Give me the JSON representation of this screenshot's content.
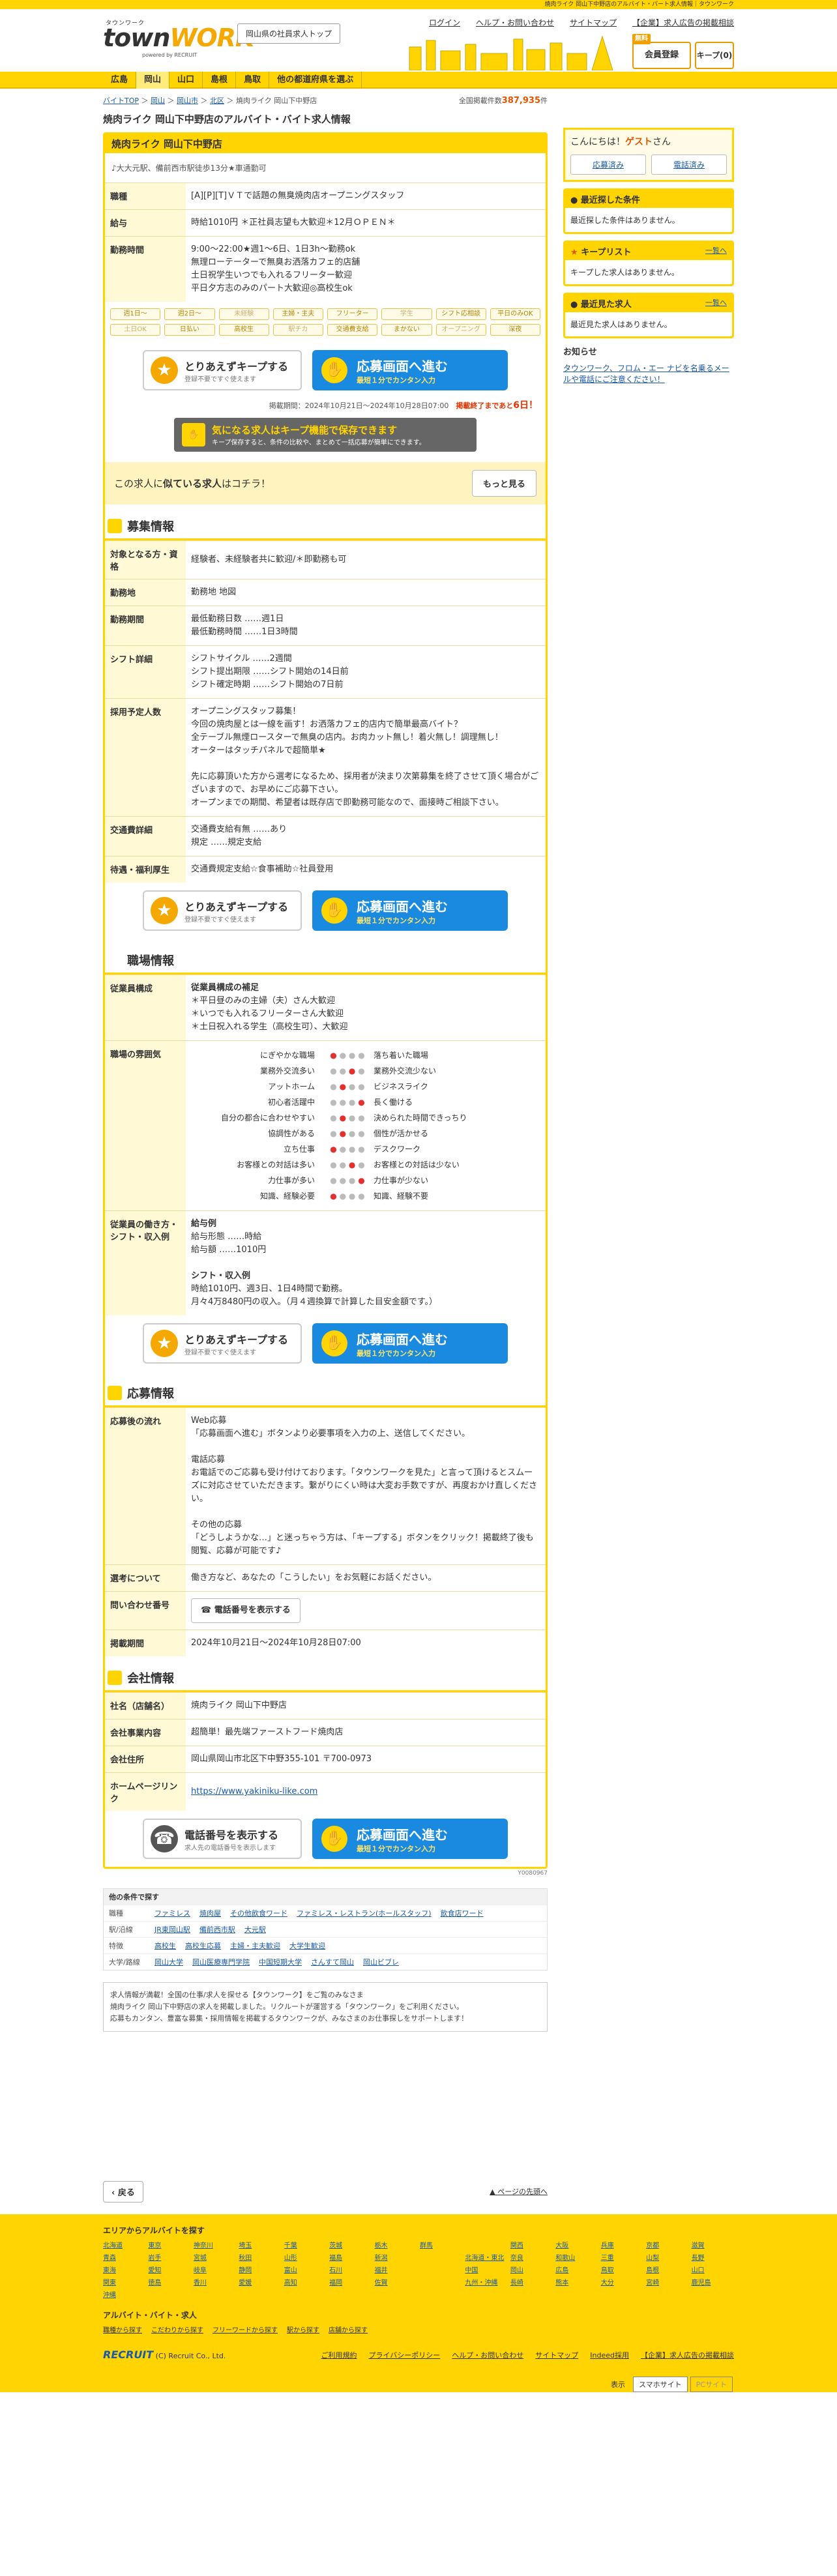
{
  "topbar": {
    "text": "焼肉ライク 岡山下中野店のアルバイト・パート求人情報｜タウンワーク"
  },
  "header": {
    "logo_small": "タウンワーク",
    "logo_big_a": "town",
    "logo_big_b": "WORK",
    "logo_sub": "powered by RECRUIT",
    "pref_button": "岡山県の社員求人トップ",
    "links": [
      "ログイン",
      "ヘルプ・お問い合わせ",
      "サイトマップ",
      "【企業】求人広告の掲載相談"
    ],
    "register_tag": "無料",
    "register": "会員登録",
    "keep": "キープ(0)"
  },
  "nav": [
    "広島",
    "岡山",
    "山口",
    "島根",
    "鳥取",
    "他の都道府県を選ぶ"
  ],
  "breadcrumb": [
    "バイトTOP",
    "岡山",
    "岡山市",
    "北区",
    "焼肉ライク 岡山下中野店"
  ],
  "total_count_label": "全国掲載件数",
  "total_count": "387,935",
  "total_unit": "件",
  "page_title": "焼肉ライク 岡山下中野店のアルバイト・バイト求人情報",
  "job": {
    "card_title": "焼肉ライク 岡山下中野店",
    "address": "♪大大元駅、備前西市駅徒歩13分★車通勤可",
    "rows": [
      {
        "k": "職種",
        "v": "[A][P][T]ＶＴで話題の無臭焼肉店オープニングスタッフ"
      },
      {
        "k": "給与",
        "v": "時給1010円 ＊正社員志望も大歓迎＊12月ＯＰＥＮ＊"
      },
      {
        "k": "勤務時間",
        "v": "9:00〜22:00★週1〜6日、1日3h〜勤務ok\n無理ローテーターで無臭お洒落カフェ的店舗\n土日祝学生いつでも入れるフリーター歓迎\n平日夕方志のみのパート大歓迎◎高校生ok"
      }
    ],
    "tags": [
      "週1日〜",
      "週2日〜",
      "未経験",
      "主婦・主夫",
      "フリーター",
      "学生",
      "シフト応相談",
      "平日のみOK",
      "土日OK",
      "日払い",
      "高校生",
      "駅チカ",
      "交通費支給",
      "まかない",
      "オープニング",
      "深夜"
    ],
    "keep_title": "とりあえずキープする",
    "keep_sub": "登録不要ですぐ使えます",
    "apply_title": "応募画面へ進む",
    "apply_sub": "最短１分でカンタン入力",
    "period": "掲載期間：2024年10月21日〜2024年10月28日07:00",
    "deadline_a": "掲載終了まであと",
    "deadline_b": "6日！",
    "keepban_title": "気になる求人はキープ機能で保存できます",
    "keepban_sub": "キープ保存すると、条件の比較や、まとめて一括応募が簡単にできます。",
    "similar_a": "この求人に",
    "similar_b": "似ている求人",
    "similar_c": "はコチラ！",
    "similar_more": "もっと見る"
  },
  "recruit": {
    "title": "募集情報",
    "rows": [
      {
        "k": "対象となる方・資格",
        "v": "経験者、未経験者共に歓迎/＊即勤務も可"
      },
      {
        "k": "勤務地",
        "v": "勤務地 地図"
      },
      {
        "k": "勤務期間",
        "v": "最低勤務日数 ……週1日\n最低勤務時間 ……1日3時間"
      },
      {
        "k": "シフト詳細",
        "v": "シフトサイクル ……2週間\nシフト提出期限 ……シフト開始の14日前\nシフト確定時期 ……シフト開始の7日前"
      },
      {
        "k": "採用予定人数",
        "v": "オープニングスタッフ募集！\n今回の焼肉屋とは一線を画す！お洒落カフェ的店内で簡単最高バイト？\n全テーブル無煙ロースターで無臭の店内。お肉カット無し！着火無し！調理無し！\nオーターはタッチパネルで超簡単★\n\n先に応募頂いた方から選考になるため、採用者が決まり次第募集を終了させて頂く場合がございますので、お早めにご応募下さい。\nオープンまでの期間、希望者は既存店で即勤務可能なので、面接時ご相談下さい。"
      },
      {
        "k": "交通費詳細",
        "v": "交通費支給有無 ……あり\n規定 ……規定支給"
      },
      {
        "k": "待遇・福利厚生",
        "v": "交通費規定支給☆食事補助☆社員登用"
      }
    ]
  },
  "workplace": {
    "title": "職場情報",
    "staff_k": "従業員構成",
    "staff_h": "従業員構成の補足",
    "staff": [
      "＊平日昼のみの主婦（夫）さん大歓迎",
      "＊いつでも入れるフリーターさん大歓迎",
      "＊土日祝入れる学生（高校生可）、大歓迎"
    ],
    "mood_k": "職場の雰囲気",
    "mood": [
      [
        "にぎやかな職場",
        "落ち着いた職場"
      ],
      [
        "業務外交流多い",
        "業務外交流少ない"
      ],
      [
        "アットホーム",
        "ビジネスライク"
      ],
      [
        "初心者活躍中",
        "長く働ける"
      ],
      [
        "自分の都合に合わせやすい",
        "決められた時間できっちり"
      ],
      [
        "協調性がある",
        "個性が活かせる"
      ],
      [
        "立ち仕事",
        "デスクワーク"
      ],
      [
        "お客様との対話は多い",
        "お客様との対話は少ない"
      ],
      [
        "力仕事が多い",
        "力仕事が少ない"
      ],
      [
        "知識、経験必要",
        "知識、経験不要"
      ]
    ],
    "ex_k": "従業員の働き方・シフト・収入例",
    "ex_pay_h": "給与例",
    "ex_pay": "給与形態 ……時給\n給与額 ……1010円",
    "ex_shift_h": "シフト・収入例",
    "ex_shift": "時給1010円、週3日、1日4時間で勤務。\n月々4万8480円の収入。（月４週換算で計算した目安金額です。）"
  },
  "apply": {
    "title": "応募情報",
    "flow_k": "応募後の流れ",
    "flow": "Web応募\n「応募画面へ進む」ボタンより必要事項を入力の上、送信してください。\n\n電話応募\nお電話でのご応募も受け付けております。「タウンワークを見た」と言って頂けるとスムーズに対応させていただきます。繋がりにくい時は大変お手数ですが、再度おかけ直しください。\n\nその他の応募\n「どうしようかな…」と迷っちゃう方は、「キープする」ボタンをクリック！掲載終了後も閲覧、応募が可能です♪",
    "note_k": "選考について",
    "note": "働き方など、あなたの「こうしたい」をお気軽にお話ください。",
    "tel_k": "問い合わせ番号",
    "tel_btn": "電話番号を表示する",
    "period_k": "掲載期間",
    "period": "2024年10月21日〜2024年10月28日07:00"
  },
  "company": {
    "title": "会社情報",
    "rows": [
      {
        "k": "社名（店舗名）",
        "v": "焼肉ライク 岡山下中野店"
      },
      {
        "k": "会社事業内容",
        "v": "超簡単！最先端ファーストフード焼肉店"
      },
      {
        "k": "会社住所",
        "v": "岡山県岡山市北区下中野355-101 〒700-0973"
      },
      {
        "k": "ホームページリンク",
        "v": "https://www.yakiniku-like.com"
      }
    ],
    "tel_title": "電話番号を表示する",
    "tel_sub": "求人先の電話番号を表示します",
    "code": "Y0080967"
  },
  "other": {
    "title": "他の条件で探す",
    "rows": [
      {
        "k": "職種",
        "v": [
          "ファミレス",
          "焼肉屋",
          "その他飲食ワード",
          "ファミレス・レストラン(ホールスタッフ)",
          "飲食店ワード"
        ]
      },
      {
        "k": "駅/沿線",
        "v": [
          "JR東岡山駅",
          "備前西市駅",
          "大元駅"
        ]
      },
      {
        "k": "特徴",
        "v": [
          "高校生",
          "高校生応募",
          "主婦・主夫歓迎",
          "大学生歓迎"
        ]
      },
      {
        "k": "大学/路線",
        "v": [
          "岡山大学",
          "岡山医療専門学院",
          "中国短期大学",
          "さんすて岡山",
          "岡山ビブレ"
        ]
      }
    ]
  },
  "footnote": "求人情報が満載！全国の仕事/求人を探せる【タウンワーク】をご覧のみなさま\n焼肉ライク 岡山下中野店の求人を掲載しました。リクルートが運営する「タウンワーク」をご利用ください。\n応募もカンタン、豊富な募集・採用情報を掲載するタウンワークが、みなさまのお仕事探しをサポートします！",
  "back": "戻る",
  "pagetop": "ページの先頭へ",
  "sidebar": {
    "greet_a": "こんにちは！",
    "greet_b": "ゲスト",
    "greet_c": "さん",
    "applied": "応募済み",
    "called": "電話済み",
    "recent_cond_title": "最近探した条件",
    "recent_cond_body": "最近探した条件はありません。",
    "keep_title": "キープリスト",
    "keep_more": "一覧へ",
    "keep_body": "キープした求人はありません。",
    "seen_title": "最近見た求人",
    "seen_more": "一覧へ",
    "seen_body": "最近見た求人はありません。",
    "notice_title": "お知らせ",
    "notice_link": "タウンワーク、フロム・エー ナビを名乗るメールや電話にご注意ください！"
  },
  "footer": {
    "area_title": "エリアからアルバイトを探す",
    "areas": [
      "北海道",
      "東京",
      "神奈川",
      "埼玉",
      "千葉",
      "茨城",
      "栃木",
      "群馬",
      "",
      "関西",
      "大阪",
      "兵庫",
      "京都",
      "滋賀",
      "青森",
      "岩手",
      "宮城",
      "秋田",
      "山形",
      "福島",
      "新潟",
      "",
      "北海道・東北",
      "奈良",
      "和歌山",
      "三重",
      "山梨",
      "長野",
      "東海",
      "愛知",
      "岐阜",
      "静岡",
      "富山",
      "石川",
      "福井",
      "",
      "中国",
      "岡山",
      "広島",
      "鳥取",
      "島根",
      "山口",
      "関東",
      "徳島",
      "香川",
      "愛媛",
      "高知",
      "福岡",
      "佐賀",
      "",
      "九州・沖縄",
      "長崎",
      "熊本",
      "大分",
      "宮崎",
      "鹿児島",
      "沖縄"
    ],
    "job_title": "アルバイト・バイト・求人",
    "job_links": [
      "職種から探す",
      "こだわりから探す",
      "フリーワードから探す",
      "駅から探す",
      "店舗から探す"
    ],
    "copy": "(C) Recruit Co., Ltd.",
    "links": [
      "ご利用規約",
      "プライバシーポリシー",
      "ヘルプ・お問い合わせ",
      "サイトマップ",
      "Indeed採用",
      "【企業】求人広告の掲載相談"
    ],
    "display_label": "表示",
    "display_sp": "スマホサイト",
    "display_pc": "PCサイト"
  }
}
